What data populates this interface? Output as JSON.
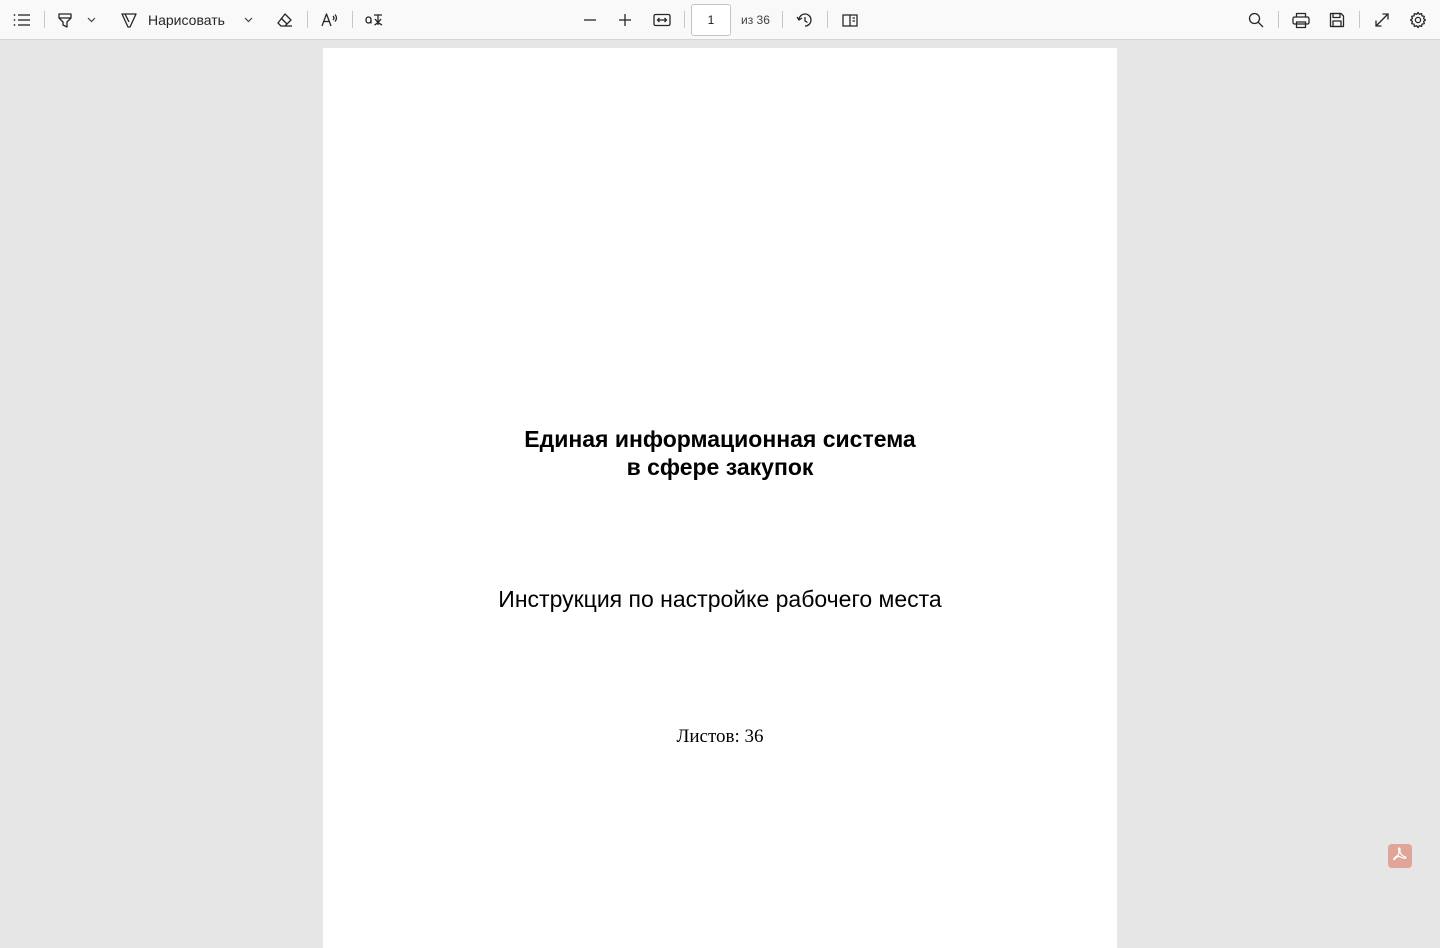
{
  "toolbar": {
    "contents_icon": "list-icon",
    "highlight_icon": "highlighter-icon",
    "draw_label": "Нарисовать",
    "erase_icon": "eraser-icon",
    "read_aloud_icon": "read-aloud-icon",
    "translate_icon": "translate-icon",
    "zoom_out_icon": "minus-icon",
    "zoom_in_icon": "plus-icon",
    "fit_icon": "fit-width-icon",
    "page_current": "1",
    "page_total": "из 36",
    "rotate_icon": "rotate-icon",
    "page_view_icon": "page-view-icon",
    "search_icon": "search-icon",
    "print_icon": "print-icon",
    "save_icon": "save-icon",
    "fullscreen_icon": "expand-icon",
    "settings_icon": "gear-icon"
  },
  "document": {
    "title_line1": "Единая информационная система",
    "title_line2": "в сфере закупок",
    "subtitle": "Инструкция по настройке рабочего места",
    "sheets": "Листов: 36"
  },
  "badge": {
    "icon": "adobe-pdf-icon",
    "color": "#e0a597"
  },
  "colors": {
    "toolbar_bg": "#f9f9f9",
    "viewer_bg": "#e6e6e6",
    "page_bg": "#ffffff"
  }
}
